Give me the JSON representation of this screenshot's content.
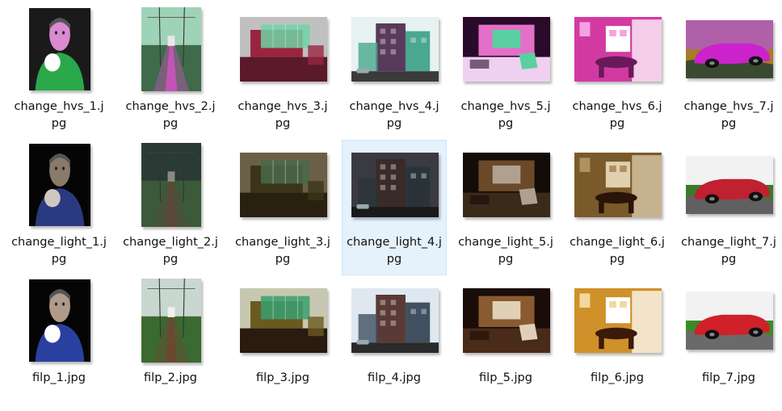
{
  "files": [
    {
      "name": "change_hvs_1.jpg",
      "scene": "portrait",
      "tone": "hvs",
      "colors": [
        "#1a1a1a",
        "#2aa84a",
        "#d98ad0",
        "#ffffff"
      ]
    },
    {
      "name": "change_hvs_2.jpg",
      "scene": "railway",
      "tone": "hvs",
      "colors": [
        "#9fd3b8",
        "#c455b6",
        "#3f6b4a",
        "#e8e8e8"
      ]
    },
    {
      "name": "change_hvs_3.jpg",
      "scene": "glasshouse",
      "tone": "hvs",
      "colors": [
        "#9a2440",
        "#6fd3a4",
        "#5a1a2a",
        "#c0c0c0"
      ]
    },
    {
      "name": "change_hvs_4.jpg",
      "scene": "street",
      "tone": "hvs",
      "colors": [
        "#e7f2f1",
        "#5a3a5a",
        "#4aa890",
        "#3a3a3a"
      ]
    },
    {
      "name": "change_hvs_5.jpg",
      "scene": "interior",
      "tone": "hvs",
      "colors": [
        "#2a0a2a",
        "#e46fc8",
        "#5ad0a0",
        "#f0d0f0"
      ]
    },
    {
      "name": "change_hvs_6.jpg",
      "scene": "dining",
      "tone": "hvs",
      "colors": [
        "#d23aa2",
        "#6a1a5a",
        "#f2a4e2",
        "#ffffff"
      ]
    },
    {
      "name": "change_hvs_7.jpg",
      "scene": "car",
      "tone": "hvs",
      "colors": [
        "#b060a8",
        "#cc22cc",
        "#a67c28",
        "#3a4a30"
      ]
    },
    {
      "name": "change_light_1.jpg",
      "scene": "portrait",
      "tone": "light",
      "colors": [
        "#050505",
        "#2a3a80",
        "#8a7a6a",
        "#d0c8c0"
      ]
    },
    {
      "name": "change_light_2.jpg",
      "scene": "railway",
      "tone": "light",
      "colors": [
        "#2a3a34",
        "#5a4a3a",
        "#3a5a3a",
        "#8a8a80"
      ]
    },
    {
      "name": "change_light_3.jpg",
      "scene": "glasshouse",
      "tone": "light",
      "colors": [
        "#3a3418",
        "#4a6a4a",
        "#2a2010",
        "#6a6048"
      ]
    },
    {
      "name": "change_light_4.jpg",
      "scene": "street",
      "tone": "light",
      "colors": [
        "#3a3a42",
        "#3a2a28",
        "#2a3438",
        "#1a1a1a"
      ]
    },
    {
      "name": "change_light_5.jpg",
      "scene": "interior",
      "tone": "light",
      "colors": [
        "#140c08",
        "#6a4a28",
        "#b0a090",
        "#3a2a1a"
      ]
    },
    {
      "name": "change_light_6.jpg",
      "scene": "dining",
      "tone": "light",
      "colors": [
        "#7a5a2a",
        "#2a1408",
        "#b09060",
        "#e0d0b0"
      ]
    },
    {
      "name": "change_light_7.jpg",
      "scene": "car",
      "tone": "light",
      "colors": [
        "#f2f2f2",
        "#c02030",
        "#3a7a2a",
        "#606060"
      ]
    },
    {
      "name": "filp_1.jpg",
      "scene": "portrait",
      "tone": "flip",
      "colors": [
        "#050505",
        "#2a40a0",
        "#b09a8a",
        "#ffffff"
      ]
    },
    {
      "name": "filp_2.jpg",
      "scene": "railway",
      "tone": "flip",
      "colors": [
        "#c8d8d0",
        "#6a4a30",
        "#3a6a30",
        "#f0f0f0"
      ]
    },
    {
      "name": "filp_3.jpg",
      "scene": "glasshouse",
      "tone": "flip",
      "colors": [
        "#6a5a20",
        "#3aa070",
        "#2a1a10",
        "#c8c8b0"
      ]
    },
    {
      "name": "filp_4.jpg",
      "scene": "street",
      "tone": "flip",
      "colors": [
        "#dfe8f0",
        "#5a3a34",
        "#405060",
        "#2a2a2a"
      ]
    },
    {
      "name": "filp_5.jpg",
      "scene": "interior",
      "tone": "flip",
      "colors": [
        "#1a0c08",
        "#8a5a30",
        "#e0d0b8",
        "#4a2a18"
      ]
    },
    {
      "name": "filp_6.jpg",
      "scene": "dining",
      "tone": "flip",
      "colors": [
        "#d0902a",
        "#3a1a08",
        "#f0d8a0",
        "#ffffff"
      ]
    },
    {
      "name": "filp_7.jpg",
      "scene": "car",
      "tone": "flip",
      "colors": [
        "#f2f2f2",
        "#d0202a",
        "#3a8a2a",
        "#6a6a6a"
      ]
    }
  ],
  "selected_index": 10
}
